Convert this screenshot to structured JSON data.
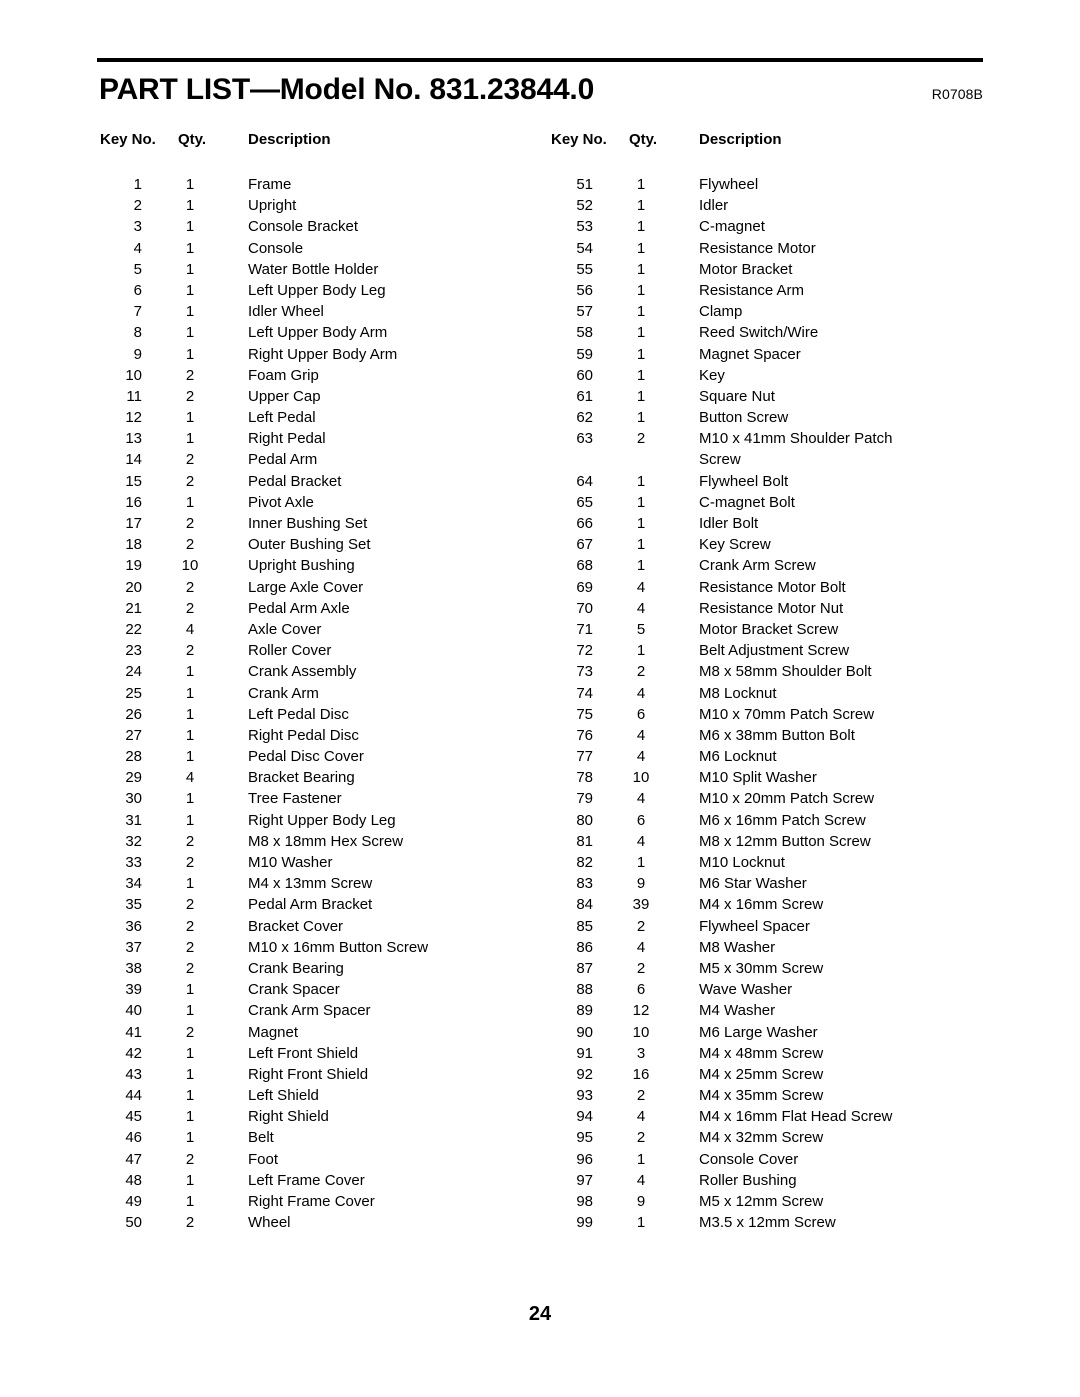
{
  "document": {
    "title": "PART LIST—Model No. 831.23844.0",
    "revision_code": "R0708B",
    "page_number": "24"
  },
  "table": {
    "headers": {
      "key_no": "Key No.",
      "qty": "Qty.",
      "description": "Description"
    },
    "left_column": [
      {
        "key": "1",
        "qty": "1",
        "desc": "Frame"
      },
      {
        "key": "2",
        "qty": "1",
        "desc": "Upright"
      },
      {
        "key": "3",
        "qty": "1",
        "desc": "Console Bracket"
      },
      {
        "key": "4",
        "qty": "1",
        "desc": "Console"
      },
      {
        "key": "5",
        "qty": "1",
        "desc": "Water Bottle Holder"
      },
      {
        "key": "6",
        "qty": "1",
        "desc": "Left Upper Body Leg"
      },
      {
        "key": "7",
        "qty": "1",
        "desc": "Idler Wheel"
      },
      {
        "key": "8",
        "qty": "1",
        "desc": "Left Upper Body Arm"
      },
      {
        "key": "9",
        "qty": "1",
        "desc": "Right Upper Body Arm"
      },
      {
        "key": "10",
        "qty": "2",
        "desc": "Foam Grip"
      },
      {
        "key": "11",
        "qty": "2",
        "desc": "Upper Cap"
      },
      {
        "key": "12",
        "qty": "1",
        "desc": "Left Pedal"
      },
      {
        "key": "13",
        "qty": "1",
        "desc": "Right Pedal"
      },
      {
        "key": "14",
        "qty": "2",
        "desc": "Pedal Arm"
      },
      {
        "key": "15",
        "qty": "2",
        "desc": "Pedal Bracket"
      },
      {
        "key": "16",
        "qty": "1",
        "desc": "Pivot Axle"
      },
      {
        "key": "17",
        "qty": "2",
        "desc": "Inner Bushing Set"
      },
      {
        "key": "18",
        "qty": "2",
        "desc": "Outer Bushing Set"
      },
      {
        "key": "19",
        "qty": "10",
        "desc": "Upright Bushing"
      },
      {
        "key": "20",
        "qty": "2",
        "desc": "Large Axle Cover"
      },
      {
        "key": "21",
        "qty": "2",
        "desc": "Pedal Arm Axle"
      },
      {
        "key": "22",
        "qty": "4",
        "desc": "Axle Cover"
      },
      {
        "key": "23",
        "qty": "2",
        "desc": "Roller Cover"
      },
      {
        "key": "24",
        "qty": "1",
        "desc": "Crank Assembly"
      },
      {
        "key": "25",
        "qty": "1",
        "desc": "Crank Arm"
      },
      {
        "key": "26",
        "qty": "1",
        "desc": "Left Pedal Disc"
      },
      {
        "key": "27",
        "qty": "1",
        "desc": "Right Pedal Disc"
      },
      {
        "key": "28",
        "qty": "1",
        "desc": "Pedal Disc Cover"
      },
      {
        "key": "29",
        "qty": "4",
        "desc": "Bracket Bearing"
      },
      {
        "key": "30",
        "qty": "1",
        "desc": "Tree Fastener"
      },
      {
        "key": "31",
        "qty": "1",
        "desc": "Right Upper Body Leg"
      },
      {
        "key": "32",
        "qty": "2",
        "desc": "M8 x 18mm Hex Screw"
      },
      {
        "key": "33",
        "qty": "2",
        "desc": "M10 Washer"
      },
      {
        "key": "34",
        "qty": "1",
        "desc": "M4 x 13mm Screw"
      },
      {
        "key": "35",
        "qty": "2",
        "desc": "Pedal Arm Bracket"
      },
      {
        "key": "36",
        "qty": "2",
        "desc": "Bracket Cover"
      },
      {
        "key": "37",
        "qty": "2",
        "desc": "M10 x 16mm Button Screw"
      },
      {
        "key": "38",
        "qty": "2",
        "desc": "Crank Bearing"
      },
      {
        "key": "39",
        "qty": "1",
        "desc": "Crank Spacer"
      },
      {
        "key": "40",
        "qty": "1",
        "desc": "Crank Arm Spacer"
      },
      {
        "key": "41",
        "qty": "2",
        "desc": "Magnet"
      },
      {
        "key": "42",
        "qty": "1",
        "desc": "Left Front Shield"
      },
      {
        "key": "43",
        "qty": "1",
        "desc": "Right Front Shield"
      },
      {
        "key": "44",
        "qty": "1",
        "desc": "Left Shield"
      },
      {
        "key": "45",
        "qty": "1",
        "desc": "Right Shield"
      },
      {
        "key": "46",
        "qty": "1",
        "desc": "Belt"
      },
      {
        "key": "47",
        "qty": "2",
        "desc": "Foot"
      },
      {
        "key": "48",
        "qty": "1",
        "desc": "Left Frame Cover"
      },
      {
        "key": "49",
        "qty": "1",
        "desc": "Right Frame Cover"
      },
      {
        "key": "50",
        "qty": "2",
        "desc": "Wheel"
      }
    ],
    "right_column": [
      {
        "key": "51",
        "qty": "1",
        "desc": "Flywheel"
      },
      {
        "key": "52",
        "qty": "1",
        "desc": "Idler"
      },
      {
        "key": "53",
        "qty": "1",
        "desc": "C-magnet"
      },
      {
        "key": "54",
        "qty": "1",
        "desc": "Resistance Motor"
      },
      {
        "key": "55",
        "qty": "1",
        "desc": "Motor Bracket"
      },
      {
        "key": "56",
        "qty": "1",
        "desc": "Resistance Arm"
      },
      {
        "key": "57",
        "qty": "1",
        "desc": "Clamp"
      },
      {
        "key": "58",
        "qty": "1",
        "desc": "Reed Switch/Wire"
      },
      {
        "key": "59",
        "qty": "1",
        "desc": "Magnet Spacer"
      },
      {
        "key": "60",
        "qty": "1",
        "desc": "Key"
      },
      {
        "key": "61",
        "qty": "1",
        "desc": "Square Nut"
      },
      {
        "key": "62",
        "qty": "1",
        "desc": "Button Screw"
      },
      {
        "key": "63",
        "qty": "2",
        "desc": "M10 x 41mm Shoulder Patch"
      },
      {
        "key": "",
        "qty": "",
        "desc": "Screw"
      },
      {
        "key": "64",
        "qty": "1",
        "desc": "Flywheel Bolt"
      },
      {
        "key": "65",
        "qty": "1",
        "desc": "C-magnet Bolt"
      },
      {
        "key": "66",
        "qty": "1",
        "desc": "Idler Bolt"
      },
      {
        "key": "67",
        "qty": "1",
        "desc": "Key Screw"
      },
      {
        "key": "68",
        "qty": "1",
        "desc": "Crank Arm Screw"
      },
      {
        "key": "69",
        "qty": "4",
        "desc": "Resistance Motor Bolt"
      },
      {
        "key": "70",
        "qty": "4",
        "desc": "Resistance Motor Nut"
      },
      {
        "key": "71",
        "qty": "5",
        "desc": "Motor Bracket Screw"
      },
      {
        "key": "72",
        "qty": "1",
        "desc": "Belt Adjustment Screw"
      },
      {
        "key": "73",
        "qty": "2",
        "desc": "M8 x 58mm Shoulder Bolt"
      },
      {
        "key": "74",
        "qty": "4",
        "desc": "M8 Locknut"
      },
      {
        "key": "75",
        "qty": "6",
        "desc": "M10 x 70mm Patch Screw"
      },
      {
        "key": "76",
        "qty": "4",
        "desc": "M6 x 38mm Button Bolt"
      },
      {
        "key": "77",
        "qty": "4",
        "desc": "M6 Locknut"
      },
      {
        "key": "78",
        "qty": "10",
        "desc": "M10 Split Washer"
      },
      {
        "key": "79",
        "qty": "4",
        "desc": "M10 x 20mm Patch Screw"
      },
      {
        "key": "80",
        "qty": "6",
        "desc": "M6 x 16mm Patch Screw"
      },
      {
        "key": "81",
        "qty": "4",
        "desc": "M8 x 12mm Button Screw"
      },
      {
        "key": "82",
        "qty": "1",
        "desc": "M10 Locknut"
      },
      {
        "key": "83",
        "qty": "9",
        "desc": "M6 Star Washer"
      },
      {
        "key": "84",
        "qty": "39",
        "desc": "M4 x 16mm Screw"
      },
      {
        "key": "85",
        "qty": "2",
        "desc": "Flywheel Spacer"
      },
      {
        "key": "86",
        "qty": "4",
        "desc": "M8 Washer"
      },
      {
        "key": "87",
        "qty": "2",
        "desc": "M5 x 30mm Screw"
      },
      {
        "key": "88",
        "qty": "6",
        "desc": "Wave Washer"
      },
      {
        "key": "89",
        "qty": "12",
        "desc": "M4 Washer"
      },
      {
        "key": "90",
        "qty": "10",
        "desc": "M6 Large Washer"
      },
      {
        "key": "91",
        "qty": "3",
        "desc": "M4 x 48mm Screw"
      },
      {
        "key": "92",
        "qty": "16",
        "desc": "M4 x 25mm Screw"
      },
      {
        "key": "93",
        "qty": "2",
        "desc": "M4 x 35mm Screw"
      },
      {
        "key": "94",
        "qty": "4",
        "desc": "M4 x 16mm Flat Head Screw"
      },
      {
        "key": "95",
        "qty": "2",
        "desc": "M4 x 32mm Screw"
      },
      {
        "key": "96",
        "qty": "1",
        "desc": "Console Cover"
      },
      {
        "key": "97",
        "qty": "4",
        "desc": "Roller Bushing"
      },
      {
        "key": "98",
        "qty": "9",
        "desc": "M5 x 12mm Screw"
      },
      {
        "key": "99",
        "qty": "1",
        "desc": "M3.5 x 12mm Screw"
      }
    ]
  }
}
